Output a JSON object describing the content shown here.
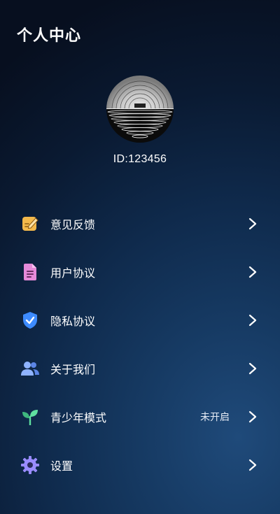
{
  "header": {
    "title": "个人中心"
  },
  "profile": {
    "id_text": "ID:123456"
  },
  "menu": {
    "items": [
      {
        "label": "意见反馈",
        "icon": "feedback-icon"
      },
      {
        "label": "用户协议",
        "icon": "document-icon"
      },
      {
        "label": "隐私协议",
        "icon": "shield-check-icon"
      },
      {
        "label": "关于我们",
        "icon": "users-icon"
      },
      {
        "label": "青少年模式",
        "icon": "sprout-icon",
        "value": "未开启"
      },
      {
        "label": "设置",
        "icon": "gear-icon"
      }
    ]
  },
  "colors": {
    "feedback": "#f2b84b",
    "document": "#e58ad8",
    "shield": "#3d8bff",
    "users": "#8fb3ff",
    "sprout": "#5fe0a0",
    "gear": "#9a8cff"
  }
}
